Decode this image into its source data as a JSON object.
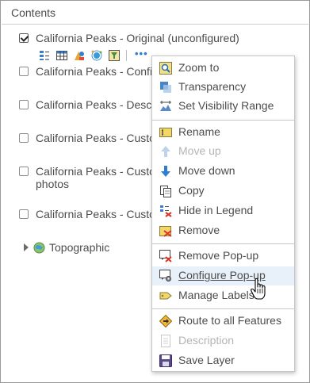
{
  "panel": {
    "title": "Contents"
  },
  "layers": [
    {
      "label": "California Peaks - Original (unconfigured)",
      "checked": true
    },
    {
      "label": "California Peaks - Confi",
      "checked": false
    },
    {
      "label": "California Peaks - Descr",
      "checked": false
    },
    {
      "label": "California Peaks - Custo",
      "checked": false
    },
    {
      "label": "California Peaks - Custo",
      "label2": "photos",
      "checked": false
    },
    {
      "label": "California Peaks - Custo",
      "checked": false
    }
  ],
  "toolbar": {
    "icons": [
      "legend-icon",
      "attribute-table-icon",
      "change-style-icon",
      "perform-analysis-icon",
      "filter-icon"
    ],
    "more_label": "•••"
  },
  "basemap": {
    "label": "Topographic"
  },
  "menu": {
    "items": [
      {
        "label": "Zoom to",
        "icon": "zoom-to-icon",
        "enabled": true
      },
      {
        "label": "Transparency",
        "icon": "transparency-icon",
        "enabled": true
      },
      {
        "label": "Set Visibility Range",
        "icon": "visibility-range-icon",
        "enabled": true
      },
      {
        "label": "Rename",
        "icon": "rename-icon",
        "enabled": true
      },
      {
        "label": "Move up",
        "icon": "arrow-up-icon",
        "enabled": false
      },
      {
        "label": "Move down",
        "icon": "arrow-down-icon",
        "enabled": true
      },
      {
        "label": "Copy",
        "icon": "copy-icon",
        "enabled": true
      },
      {
        "label": "Hide in Legend",
        "icon": "hide-in-legend-icon",
        "enabled": true
      },
      {
        "label": "Remove",
        "icon": "remove-icon",
        "enabled": true
      },
      {
        "label": "Remove Pop-up",
        "icon": "remove-popup-icon",
        "enabled": true
      },
      {
        "label": "Configure Pop-up",
        "icon": "configure-popup-icon",
        "enabled": true,
        "hovered": true
      },
      {
        "label": "Manage Labels",
        "icon": "manage-labels-icon",
        "enabled": true
      },
      {
        "label": "Route to all Features",
        "icon": "route-icon",
        "enabled": true
      },
      {
        "label": "Description",
        "icon": "description-icon",
        "enabled": false
      },
      {
        "label": "Save Layer",
        "icon": "save-icon",
        "enabled": true
      }
    ]
  },
  "colors": {
    "accent": "#2d7fd3",
    "hover_bg": "#e8f0f9",
    "text": "#4c4c4c",
    "disabled": "#b4b4b4"
  }
}
